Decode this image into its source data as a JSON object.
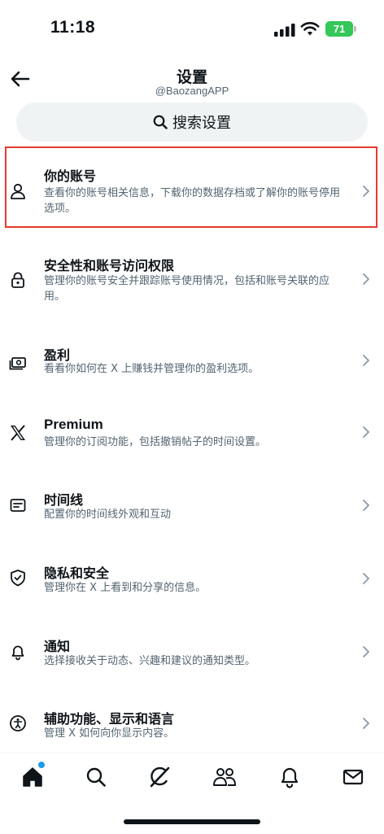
{
  "status_bar": {
    "time": "11:18",
    "battery": "71"
  },
  "header": {
    "title": "设置",
    "account": "@BaozangAPP",
    "back_icon": "back-arrow-icon"
  },
  "search": {
    "placeholder": "搜索设置",
    "icon": "search-icon"
  },
  "settings": [
    {
      "icon": "person-icon",
      "title": "你的账号",
      "desc": "查看你的账号相关信息，下载你的数据存档或了解你的账号停用选项。",
      "highlighted": true
    },
    {
      "icon": "lock-icon",
      "title": "安全性和账号访问权限",
      "desc": "管理你的账号安全并跟踪账号使用情况，包括和账号关联的应用。"
    },
    {
      "icon": "money-icon",
      "title": "盈利",
      "desc": "看看你如何在 X 上赚钱并管理你的盈利选项。"
    },
    {
      "icon": "x-logo-icon",
      "title": "Premium",
      "desc": "管理你的订阅功能，包括撤销帖子的时间设置。"
    },
    {
      "icon": "timeline-icon",
      "title": "时间线",
      "desc": "配置你的时间线外观和互动"
    },
    {
      "icon": "shield-icon",
      "title": "隐私和安全",
      "desc": "管理你在 X 上看到和分享的信息。"
    },
    {
      "icon": "bell-icon",
      "title": "通知",
      "desc": "选择接收关于动态、兴趣和建议的通知类型。"
    },
    {
      "icon": "accessibility-icon",
      "title": "辅助功能、显示和语言",
      "desc": "管理 X 如何向你显示内容。"
    }
  ],
  "bottom_nav": [
    {
      "icon": "home-icon",
      "active": true,
      "has_notification_dot": true
    },
    {
      "icon": "search-icon"
    },
    {
      "icon": "grok-icon"
    },
    {
      "icon": "communities-icon"
    },
    {
      "icon": "bell-icon"
    },
    {
      "icon": "mail-icon"
    }
  ],
  "colors": {
    "text": "#0f1419",
    "secondary": "#536471",
    "highlight": "#e63a2e",
    "accent": "#1d9bf0",
    "battery": "#34c759",
    "search_bg": "#eff3f4"
  }
}
